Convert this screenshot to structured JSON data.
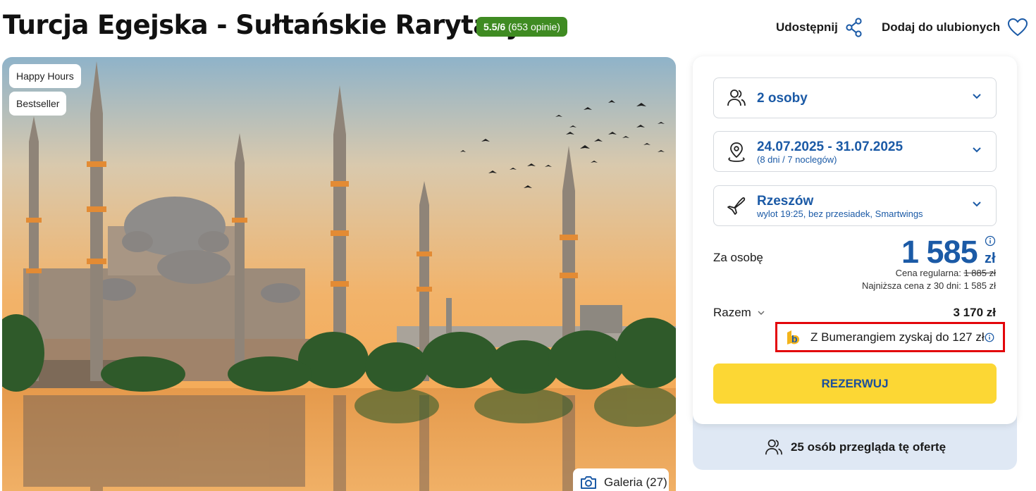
{
  "header": {
    "title": "Turcja Egejska - Sułtańskie Rarytasy",
    "rating_score": "5.5/6",
    "rating_count": "(653 opinie)",
    "rating_color": "#3f8b22",
    "share_label": "Udostępnij",
    "share_icon": "share-icon",
    "favorite_label": "Dodaj do ulubionych",
    "favorite_icon": "heart-icon"
  },
  "hero": {
    "badges": [
      "Happy Hours",
      "Bestseller"
    ],
    "gallery_label": "Galeria (27)",
    "gallery_icon": "camera-icon"
  },
  "booking": {
    "persons": {
      "label": "2 osoby",
      "icon": "people-icon"
    },
    "dates": {
      "label": "24.07.2025 - 31.07.2025",
      "sub": "(8 dni / 7 noclegów)",
      "icon": "location-pin-icon"
    },
    "departure": {
      "label": "Rzeszów",
      "sub": "wylot 19:25, bez przesiadek, Smartwings",
      "icon": "plane-icon"
    },
    "per_person_label": "Za osobę",
    "price": "1 585",
    "currency": "zł",
    "regular_price_label": "Cena regularna:",
    "regular_price": "1 885 zł",
    "lowest_price": "Najniższa cena z 30 dni: 1 585 zł",
    "total_label": "Razem",
    "total_value": "3 170 zł",
    "bumerang_text": "Z Bumerangiem zyskaj do 127 zł",
    "reserve_label": "REZERWUJ",
    "accent_color": "#1b5aa6",
    "button_color": "#fcd734"
  },
  "viewers": {
    "text": "25 osób przegląda tę ofertę",
    "icon": "people-icon"
  }
}
